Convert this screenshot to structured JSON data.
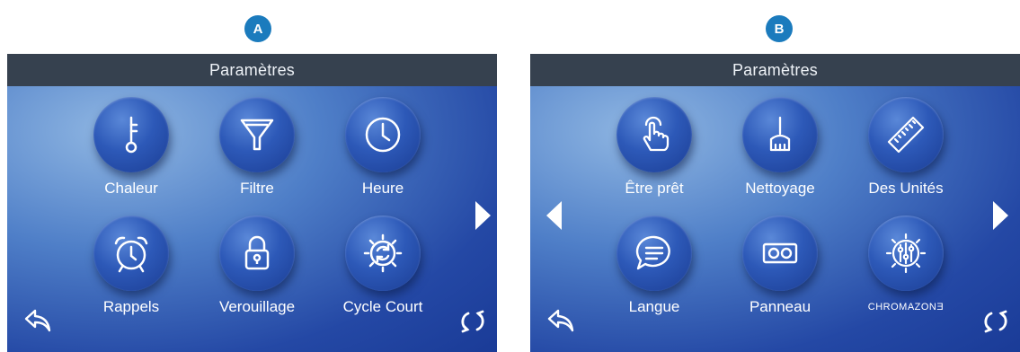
{
  "markers": {
    "a": "A",
    "b": "B"
  },
  "panel_a": {
    "title": "Paramètres",
    "items": [
      {
        "label": "Chaleur",
        "icon": "thermometer-icon"
      },
      {
        "label": "Filtre",
        "icon": "filter-icon"
      },
      {
        "label": "Heure",
        "icon": "clock-icon"
      },
      {
        "label": "Rappels",
        "icon": "alarm-clock-icon"
      },
      {
        "label": "Verouillage",
        "icon": "lock-icon"
      },
      {
        "label": "Cycle Court",
        "icon": "cycle-icon"
      }
    ]
  },
  "panel_b": {
    "title": "Paramètres",
    "items": [
      {
        "label": "Être prêt",
        "icon": "touch-hand-icon"
      },
      {
        "label": "Nettoyage",
        "icon": "broom-icon"
      },
      {
        "label": "Des Unités",
        "icon": "ruler-icon"
      },
      {
        "label": "Langue",
        "icon": "chat-bubble-icon"
      },
      {
        "label": "Panneau",
        "icon": "panel-icon"
      },
      {
        "label": "CHROMAZONƎ",
        "icon": "chromazone-icon"
      }
    ]
  },
  "colors": {
    "marker": "#1b7bbd",
    "titlebar": "#36414f",
    "panel": "#2448a5"
  }
}
